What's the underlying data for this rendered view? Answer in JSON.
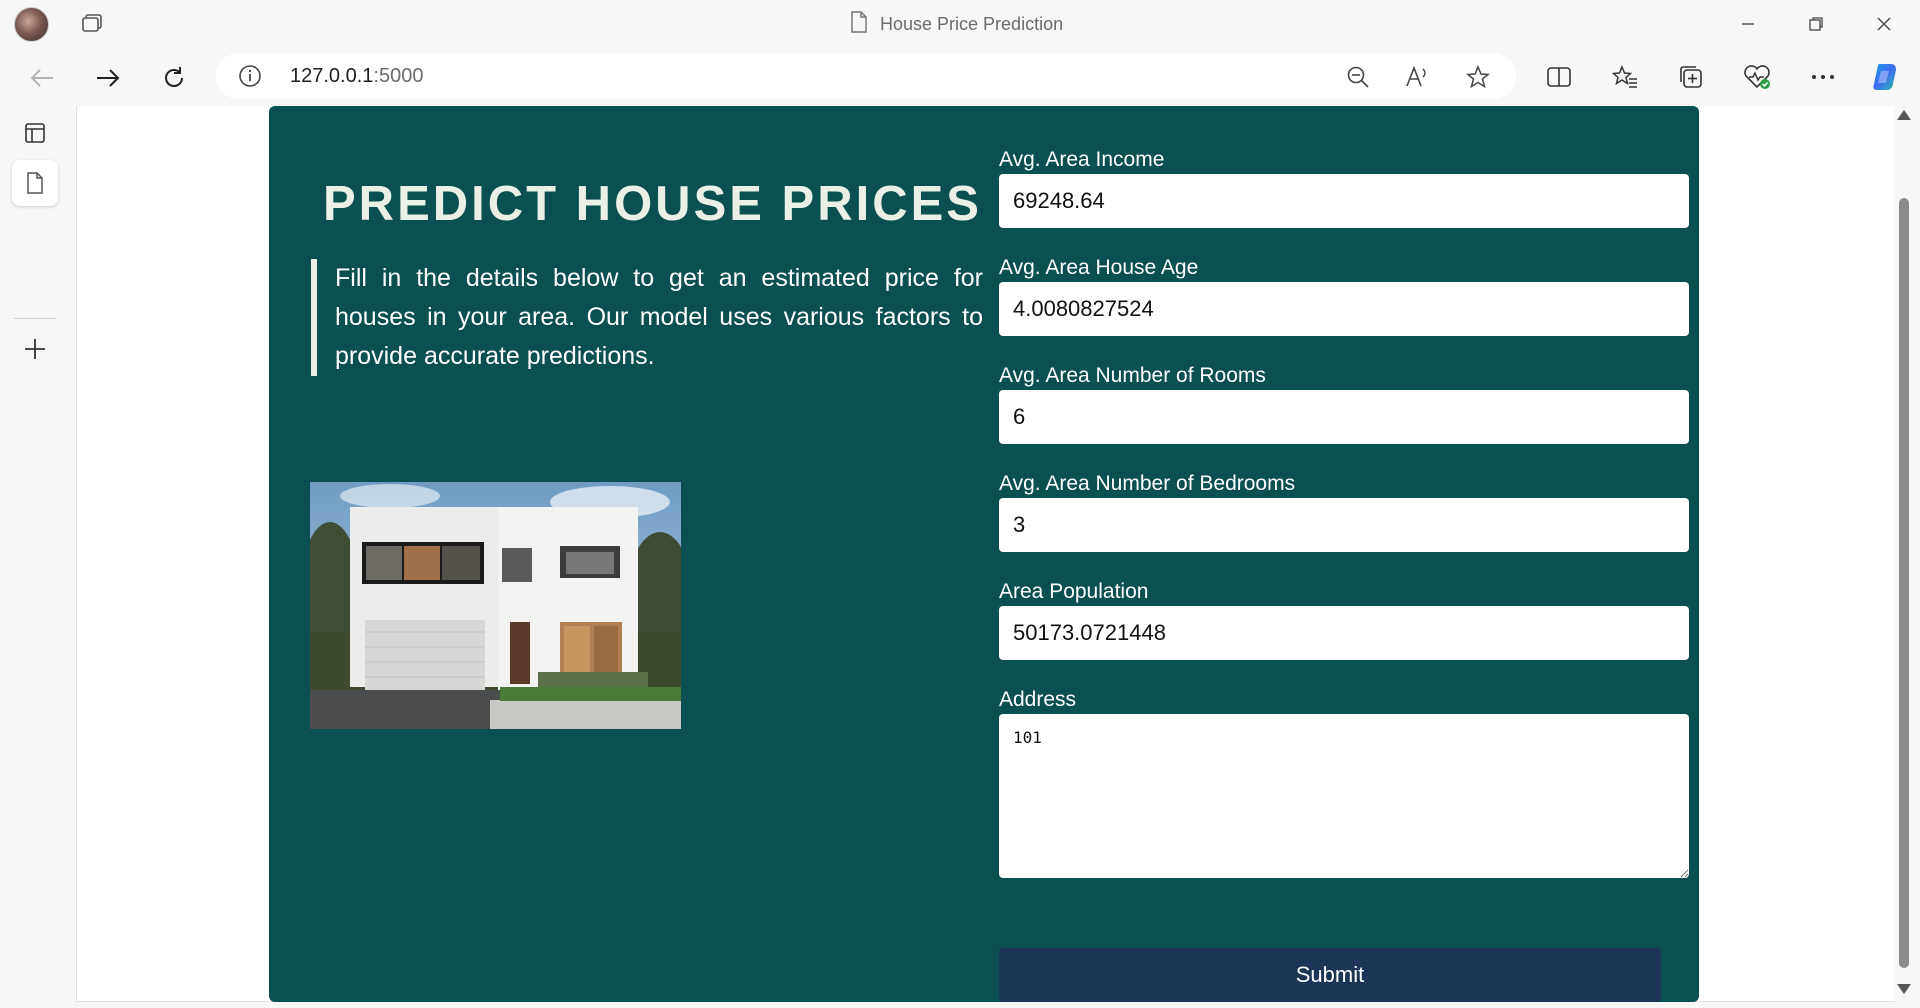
{
  "browser": {
    "window_title": "House Price Prediction",
    "url_host": "127.0.0.1",
    "url_port": ":5000"
  },
  "page": {
    "heading": "PREDICT HOUSE PRICES",
    "description": "Fill in the details below to get an estimated price for houses in your area. Our model uses various factors to provide accurate predictions.",
    "image_icon": "house-photo",
    "colors": {
      "card_background": "#0b5050",
      "submit_background": "#1c3556",
      "heading_color": "#eaf0e6"
    }
  },
  "form": {
    "income": {
      "label": "Avg. Area Income",
      "value": "69248.64"
    },
    "house_age": {
      "label": "Avg. Area House Age",
      "value": "4.0080827524"
    },
    "rooms": {
      "label": "Avg. Area Number of Rooms",
      "value": "6"
    },
    "bedrooms": {
      "label": "Avg. Area Number of Bedrooms",
      "value": "3"
    },
    "population": {
      "label": "Area Population",
      "value": "50173.0721448"
    },
    "address": {
      "label": "Address",
      "value": "101"
    },
    "submit_label": "Submit"
  }
}
